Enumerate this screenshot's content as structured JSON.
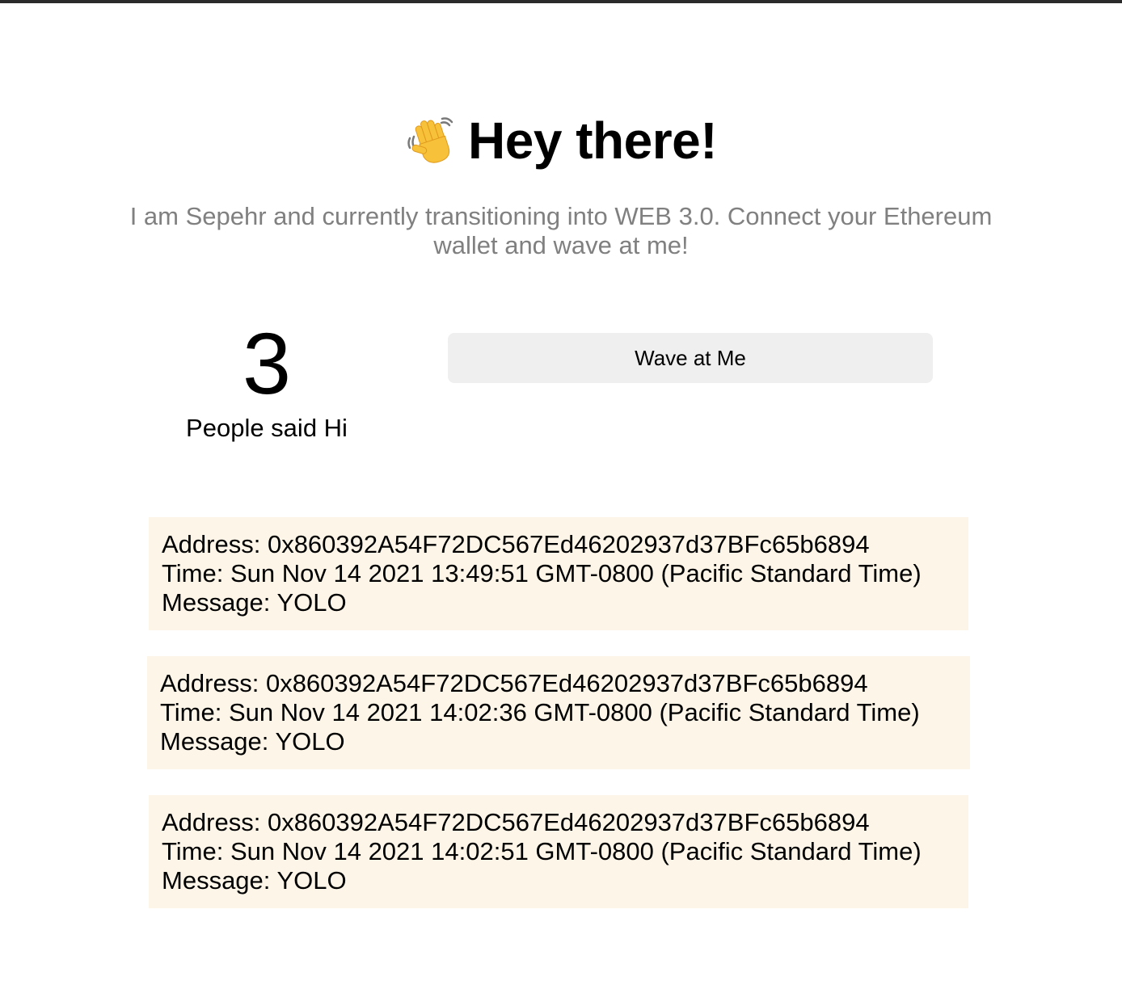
{
  "header": {
    "icon": "waving-hand-icon",
    "title": "Hey there!"
  },
  "subtitle": "I am Sepehr and currently transitioning into WEB 3.0. Connect your Ethereum wallet and wave at me!",
  "counter": {
    "count": "3",
    "label": "People said Hi"
  },
  "wave_button": {
    "label": "Wave at Me"
  },
  "waves": [
    {
      "address": "Address: 0x860392A54F72DC567Ed46202937d37BFc65b6894",
      "time": "Time: Sun Nov 14 2021 13:49:51 GMT-0800 (Pacific Standard Time)",
      "message": "Message: YOLO"
    },
    {
      "address": "Address: 0x860392A54F72DC567Ed46202937d37BFc65b6894",
      "time": "Time: Sun Nov 14 2021 14:02:36 GMT-0800 (Pacific Standard Time)",
      "message": "Message: YOLO"
    },
    {
      "address": "Address: 0x860392A54F72DC567Ed46202937d37BFc65b6894",
      "time": "Time: Sun Nov 14 2021 14:02:51 GMT-0800 (Pacific Standard Time)",
      "message": "Message: YOLO"
    }
  ],
  "colors": {
    "card_background": "#fdf5e8",
    "button_background": "#efefef",
    "subtitle_text": "#808080"
  }
}
